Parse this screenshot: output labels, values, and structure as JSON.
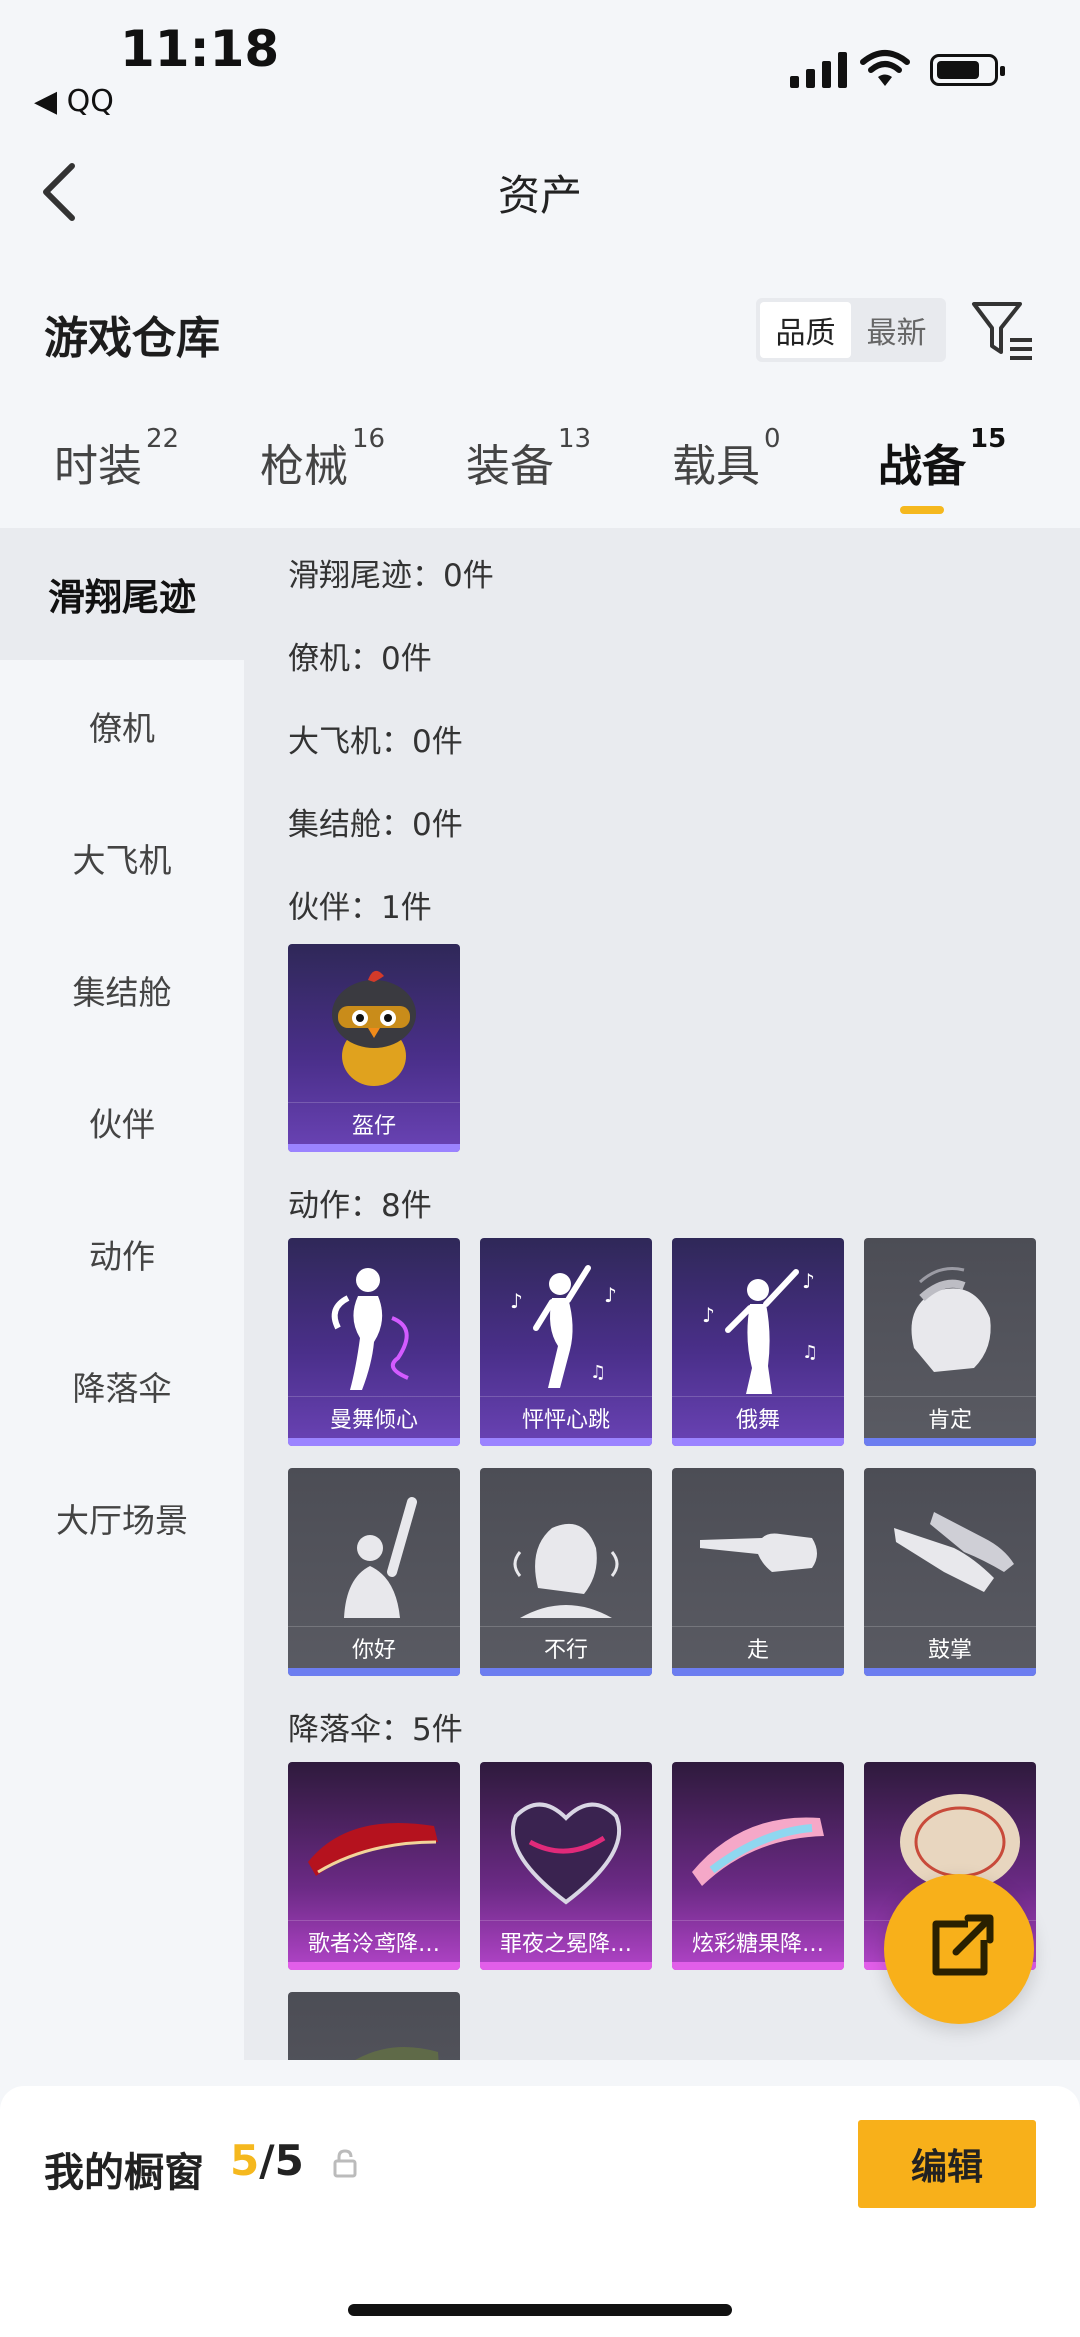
{
  "status_bar": {
    "time": "11:18",
    "back_app": "◀ QQ"
  },
  "nav": {
    "title": "资产"
  },
  "header": {
    "title": "游戏仓库",
    "sort_options": [
      "品质",
      "最新"
    ],
    "selected_sort": "品质"
  },
  "tabs": [
    {
      "label": "时装",
      "count": "22"
    },
    {
      "label": "枪械",
      "count": "16"
    },
    {
      "label": "装备",
      "count": "13"
    },
    {
      "label": "载具",
      "count": "0"
    },
    {
      "label": "战备",
      "count": "15",
      "active": true
    }
  ],
  "sidebar": {
    "items": [
      {
        "label": "滑翔尾迹",
        "active": true
      },
      {
        "label": "僚机"
      },
      {
        "label": "大飞机"
      },
      {
        "label": "集结舱"
      },
      {
        "label": "伙伴"
      },
      {
        "label": "动作"
      },
      {
        "label": "降落伞"
      },
      {
        "label": "大厅场景"
      }
    ]
  },
  "sections": [
    {
      "label": "滑翔尾迹：0件"
    },
    {
      "label": "僚机：0件"
    },
    {
      "label": "大飞机：0件"
    },
    {
      "label": "集结舱：0件"
    },
    {
      "label": "伙伴：1件",
      "items": [
        {
          "name": "盔仔",
          "style": "purple",
          "icon": "helmet-chick-icon"
        }
      ]
    },
    {
      "label": "动作：8件",
      "items": [
        {
          "name": "曼舞倾心",
          "style": "purple",
          "icon": "dance-icon"
        },
        {
          "name": "怦怦心跳",
          "style": "purple",
          "icon": "dance-icon"
        },
        {
          "name": "俄舞",
          "style": "purple",
          "icon": "dance-icon"
        },
        {
          "name": "肯定",
          "style": "gray",
          "icon": "nod-icon"
        },
        {
          "name": "你好",
          "style": "gray",
          "icon": "wave-icon"
        },
        {
          "name": "不行",
          "style": "gray",
          "icon": "shake-head-icon"
        },
        {
          "name": "走",
          "style": "gray",
          "icon": "point-hand-icon"
        },
        {
          "name": "鼓掌",
          "style": "gray",
          "icon": "clap-icon"
        }
      ]
    },
    {
      "label": "降落伞：5件",
      "items": [
        {
          "name": "歌者泠鸢降…",
          "style": "pink",
          "icon": "parachute-icon"
        },
        {
          "name": "罪夜之冕降…",
          "style": "pink",
          "icon": "parachute-icon"
        },
        {
          "name": "炫彩糖果降…",
          "style": "pink",
          "icon": "parachute-icon"
        },
        {
          "name": "",
          "style": "pink",
          "icon": "parachute-icon"
        },
        {
          "name": "",
          "style": "gray",
          "icon": "parachute-icon"
        }
      ]
    }
  ],
  "bottom_bar": {
    "label": "我的橱窗",
    "count_current": "5",
    "count_sep_total": "/5",
    "edit_label": "编辑"
  },
  "colors": {
    "accent": "#f8b01a",
    "purple_card": "#4a2f8a",
    "gray_card": "#55565e",
    "pink_card": "#6b2a85"
  }
}
